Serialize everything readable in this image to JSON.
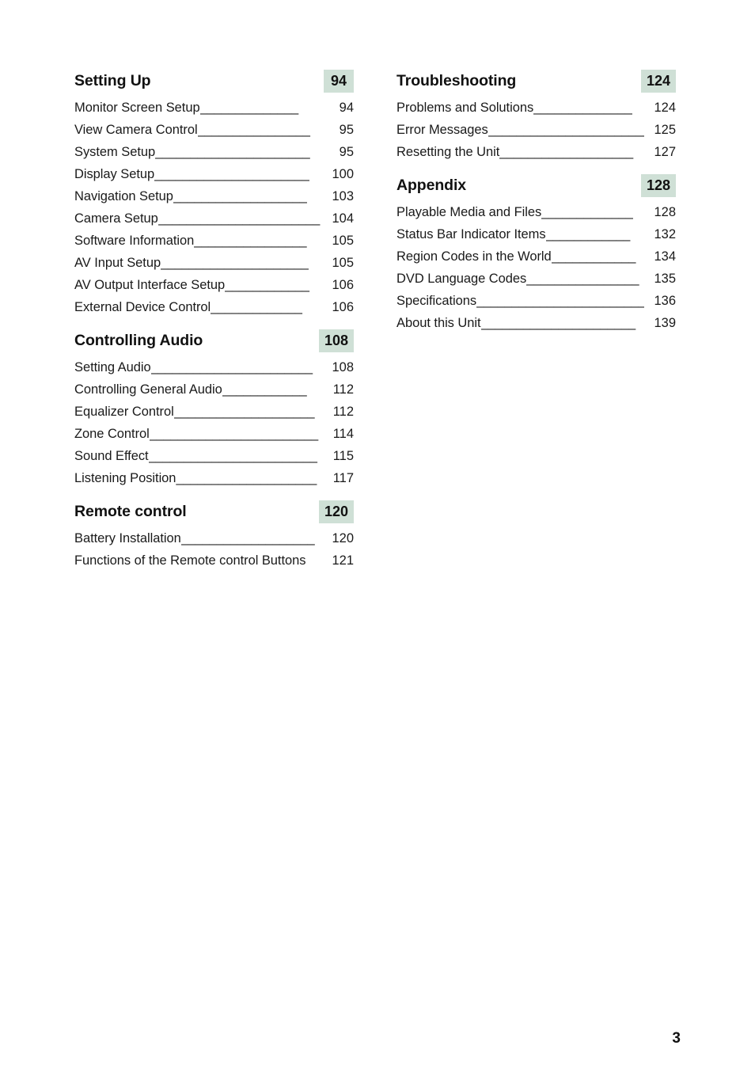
{
  "document": {
    "folio": "3",
    "accent_badge_color": "#cfe0d6",
    "text_color": "#1a1a1a"
  },
  "columns": {
    "left": {
      "sections": [
        {
          "title": "Setting Up",
          "page": "94",
          "entries": [
            {
              "label": "Monitor Screen Setup",
              "leader": "______________",
              "page": "94"
            },
            {
              "label": "View Camera Control",
              "leader": "________________",
              "page": "95"
            },
            {
              "label": "System Setup",
              "leader": "______________________",
              "page": "95"
            },
            {
              "label": "Display Setup",
              "leader": "______________________",
              "page": "100"
            },
            {
              "label": "Navigation Setup",
              "leader": "___________________",
              "page": "103"
            },
            {
              "label": "Camera Setup",
              "leader": "_______________________",
              "page": "104"
            },
            {
              "label": "Software Information",
              "leader": "________________",
              "page": "105"
            },
            {
              "label": "AV Input Setup",
              "leader": "_____________________",
              "page": "105"
            },
            {
              "label": "AV Output Interface Setup",
              "leader": "____________",
              "page": "106"
            },
            {
              "label": "External Device Control",
              "leader": "_____________",
              "page": "106"
            }
          ]
        },
        {
          "title": "Controlling Audio",
          "page": "108",
          "entries": [
            {
              "label": "Setting Audio",
              "leader": "_______________________",
              "page": "108"
            },
            {
              "label": "Controlling General Audio",
              "leader": "____________",
              "page": "112"
            },
            {
              "label": "Equalizer Control",
              "leader": "____________________",
              "page": "112"
            },
            {
              "label": "Zone Control",
              "leader": "________________________",
              "page": "114"
            },
            {
              "label": "Sound Effect",
              "leader": "________________________",
              "page": "115"
            },
            {
              "label": "Listening Position",
              "leader": "____________________",
              "page": "117"
            }
          ]
        },
        {
          "title": "Remote control",
          "page": "120",
          "entries": [
            {
              "label": "Battery Installation",
              "leader": "___________________",
              "page": "120"
            },
            {
              "label": "Functions of the Remote control Buttons",
              "leader": "",
              "page": "121"
            }
          ]
        }
      ]
    },
    "right": {
      "sections": [
        {
          "title": "Troubleshooting",
          "page": "124",
          "entries": [
            {
              "label": "Problems and Solutions",
              "leader": "______________",
              "page": "124"
            },
            {
              "label": "Error Messages",
              "leader": "_______________________",
              "page": "125"
            },
            {
              "label": "Resetting the Unit",
              "leader": "___________________",
              "page": "127"
            }
          ]
        },
        {
          "title": "Appendix",
          "page": "128",
          "entries": [
            {
              "label": "Playable Media and Files",
              "leader": "_____________",
              "page": "128"
            },
            {
              "label": "Status Bar Indicator Items",
              "leader": "____________",
              "page": "132"
            },
            {
              "label": "Region Codes in the World",
              "leader": "____________",
              "page": "134"
            },
            {
              "label": "DVD Language Codes",
              "leader": "________________",
              "page": "135"
            },
            {
              "label": "Specifications",
              "leader": "________________________",
              "page": "136"
            },
            {
              "label": "About this Unit",
              "leader": "______________________",
              "page": "139"
            }
          ]
        }
      ]
    }
  }
}
